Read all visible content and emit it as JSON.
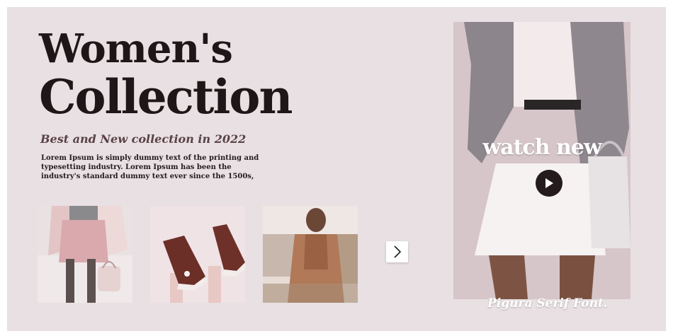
{
  "hero": {
    "title_line1": "Women's",
    "title_line2": "Collection",
    "subtitle": "Best and New collection in 2022",
    "body": "Lorem Ipsum is simply dummy text of the printing and typesetting industry. Lorem Ipsum has been the industry's standard dummy text ever since the 1500s,"
  },
  "gallery": {
    "thumbnails": [
      {
        "name": "woman-pink-coat-photo"
      },
      {
        "name": "brown-sneakers-photo"
      },
      {
        "name": "camel-outfit-photo"
      }
    ],
    "next_icon": "chevron-right-icon"
  },
  "video": {
    "heading": "watch new",
    "play_icon": "play-icon",
    "caption": "Pigura Serif Font."
  },
  "colors": {
    "background": "#e8e0e2",
    "title": "#1d1717",
    "subtitle": "#5a4148",
    "play_button": "#241b1c"
  }
}
